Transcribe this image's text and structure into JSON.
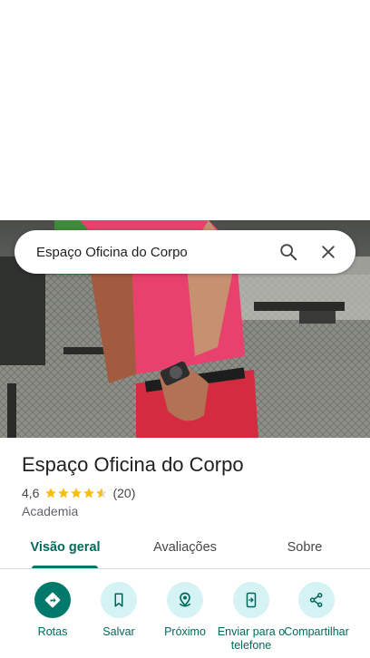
{
  "search": {
    "query": "Espaço Oficina do Corpo"
  },
  "place": {
    "name": "Espaço Oficina do Corpo",
    "rating": "4,6",
    "rating_value": 4.6,
    "review_count": "(20)",
    "category": "Academia"
  },
  "tabs": [
    {
      "label": "Visão geral",
      "active": true
    },
    {
      "label": "Avaliações",
      "active": false
    },
    {
      "label": "Sobre",
      "active": false
    }
  ],
  "actions": [
    {
      "label": "Rotas",
      "icon": "directions-icon"
    },
    {
      "label": "Salvar",
      "icon": "bookmark-icon"
    },
    {
      "label": "Próximo",
      "icon": "nearby-icon"
    },
    {
      "label": "Enviar para o telefone",
      "icon": "send-to-phone-icon"
    },
    {
      "label": "Compartilhar",
      "icon": "share-icon"
    }
  ],
  "colors": {
    "accent": "#00796b",
    "action_bg": "#d5f2f4",
    "star": "#fbbc04"
  }
}
